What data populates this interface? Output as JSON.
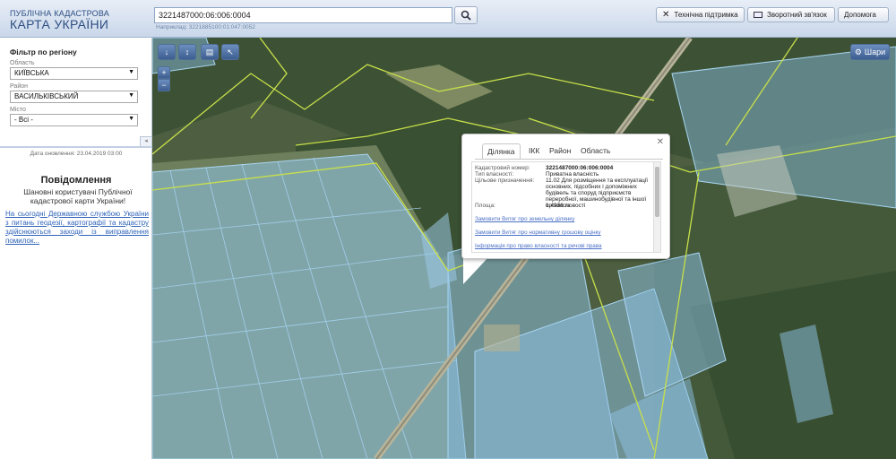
{
  "header": {
    "logo_line1": "ПУБЛІЧНА КАДАСТРОВА",
    "logo_line2": "КАРТА УКРАЇНИ",
    "search_value": "3221487000:06:006:0004",
    "search_hint": "Наприклад: 3221885100:01:047:0052",
    "support_label": "Технічна підтримка",
    "feedback_label": "Зворотний зв'язок",
    "help_label": "Допомога"
  },
  "sidebar": {
    "filter_title": "Фільтр по регіону",
    "region_label": "Область",
    "region_value": "КИЇВСЬКА",
    "district_label": "Район",
    "district_value": "ВАСИЛЬКІВСЬКИЙ",
    "city_label": "Місто",
    "city_value": "- Всі -",
    "updated": "Дата оновлення: 23.04.2019 03:00",
    "notice_title": "Повідомлення",
    "notice_text": "Шановні користувачі Публічної кадастрової карти України!",
    "notice_link": "На сьогодні Державною службою України з питань геодезії, картографії та кадастру здійснюються заходи із виправлення помилок..."
  },
  "map": {
    "layers_label": "Шари",
    "zoom_in": "+",
    "zoom_out": "−"
  },
  "popup": {
    "tabs": [
      "Ділянка",
      "ІКК",
      "Район",
      "Область"
    ],
    "fields": [
      {
        "key": "Кадастровий номер:",
        "value": "3221487000:06:006:0004"
      },
      {
        "key": "Тип власності:",
        "value": "Приватна власність"
      },
      {
        "key": "Цільове призначення:",
        "value": "11.02 Для розміщення та експлуатації основних, підсобних і допоміжних будівель та споруд підприємств переробної, машинобудівної та іншої промисловості"
      },
      {
        "key": "Площа:",
        "value": "1.4936 га"
      }
    ],
    "links": [
      "Замовити Витяг про земельну ділянку",
      "Замовити Витяг про нормативну грошову оцінку",
      "Інформація про право власності та речові права"
    ]
  }
}
